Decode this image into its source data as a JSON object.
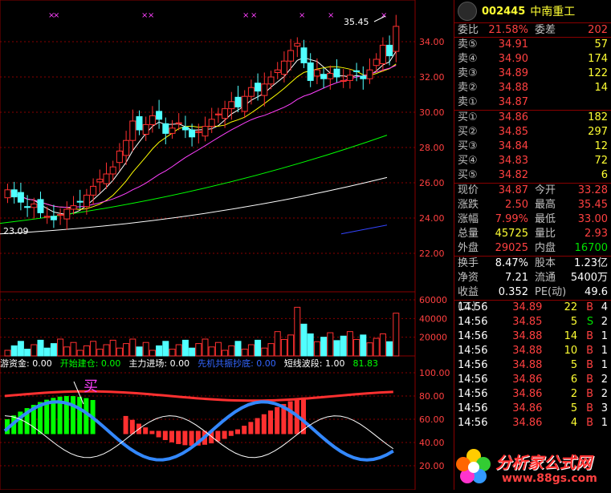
{
  "stock": {
    "code": "002445",
    "name": "中南重工"
  },
  "price_axis": [
    "34.00",
    "32.00",
    "30.00",
    "28.00",
    "26.00",
    "24.00",
    "22.00"
  ],
  "volume_axis": [
    "60000",
    "40000",
    "20000"
  ],
  "indicator_axis": [
    "100.00",
    "80.00",
    "60.00",
    "40.00",
    "20.00"
  ],
  "chart_annotations": {
    "high_label": "35.45",
    "low_label": "23.09",
    "buy_marker": "买"
  },
  "indicator_bar": {
    "items": [
      {
        "label": "游资金: 0.00",
        "color": "#ffffff"
      },
      {
        "label": "开始建仓: 0.00",
        "color": "#00ff00"
      },
      {
        "label": "主力进场: 0.00",
        "color": "#ffffff"
      },
      {
        "label": "先机共振抄底: 0.00",
        "color": "#3366ff"
      },
      {
        "label": "短线波段: 1.00",
        "color": "#ffffff"
      },
      {
        "label": "81.83",
        "color": "#00ff00"
      }
    ]
  },
  "quote": {
    "ratio": {
      "label1": "委比",
      "value1": "21.58%",
      "label2": "委差",
      "value2": "202"
    },
    "sell": [
      {
        "label": "卖⑤",
        "price": "34.91",
        "volume": "57"
      },
      {
        "label": "卖④",
        "price": "34.90",
        "volume": "174"
      },
      {
        "label": "卖③",
        "price": "34.89",
        "volume": "122"
      },
      {
        "label": "卖②",
        "price": "34.88",
        "volume": "14"
      },
      {
        "label": "卖①",
        "price": "34.87",
        "volume": ""
      }
    ],
    "buy": [
      {
        "label": "买①",
        "price": "34.86",
        "volume": "182"
      },
      {
        "label": "买②",
        "price": "34.85",
        "volume": "297"
      },
      {
        "label": "买③",
        "price": "34.84",
        "volume": "12"
      },
      {
        "label": "买④",
        "price": "34.83",
        "volume": "72"
      },
      {
        "label": "买⑤",
        "price": "34.82",
        "volume": "6"
      }
    ],
    "stats": [
      {
        "l1": "现价",
        "v1": "34.87",
        "c1": "red",
        "l2": "今开",
        "v2": "33.28",
        "c2": "red"
      },
      {
        "l1": "涨跌",
        "v1": "2.50",
        "c1": "red",
        "l2": "最高",
        "v2": "35.45",
        "c2": "red"
      },
      {
        "l1": "涨幅",
        "v1": "7.99%",
        "c1": "red",
        "l2": "最低",
        "v2": "33.00",
        "c2": "red"
      },
      {
        "l1": "总量",
        "v1": "45725",
        "c1": "yellow",
        "l2": "量比",
        "v2": "2.93",
        "c2": "red"
      },
      {
        "l1": "外盘",
        "v1": "29025",
        "c1": "red",
        "l2": "内盘",
        "v2": "16700",
        "c2": "green"
      }
    ],
    "fundamentals": [
      {
        "l1": "换手",
        "v1": "8.47%",
        "l2": "股本",
        "v2": "1.23亿"
      },
      {
        "l1": "净资",
        "v1": "7.21",
        "l2": "流通",
        "v2": "5400万"
      },
      {
        "l1": "收益(二)",
        "v1": "0.352",
        "l2": "PE(动)",
        "v2": "49.6"
      }
    ],
    "trades": [
      {
        "time": "14:56",
        "price": "34.89",
        "vol": "22",
        "side": "B",
        "cnt": "4"
      },
      {
        "time": "14:56",
        "price": "34.85",
        "vol": "5",
        "side": "S",
        "cnt": "2"
      },
      {
        "time": "14:56",
        "price": "34.88",
        "vol": "14",
        "side": "B",
        "cnt": "1"
      },
      {
        "time": "14:56",
        "price": "34.88",
        "vol": "10",
        "side": "B",
        "cnt": "1"
      },
      {
        "time": "14:56",
        "price": "34.88",
        "vol": "5",
        "side": "B",
        "cnt": "1"
      },
      {
        "time": "14:56",
        "price": "34.86",
        "vol": "6",
        "side": "B",
        "cnt": "2"
      },
      {
        "time": "14:56",
        "price": "34.86",
        "vol": "2",
        "side": "B",
        "cnt": "2"
      },
      {
        "time": "14:56",
        "price": "34.86",
        "vol": "5",
        "side": "B",
        "cnt": "3"
      },
      {
        "time": "14:56",
        "price": "34.86",
        "vol": "4",
        "side": "B",
        "cnt": "1"
      }
    ]
  },
  "watermark": {
    "title": "分析家公式网",
    "url": "www.88gs.com"
  },
  "colors": {
    "up": "#ff3030",
    "down": "#50ffff",
    "bg": "#000000",
    "grid": "#8a0000",
    "ma5": "#ffffff",
    "ma10": "#ffff00",
    "ma20": "#ff40ff",
    "ma60": "#00ff00"
  }
}
